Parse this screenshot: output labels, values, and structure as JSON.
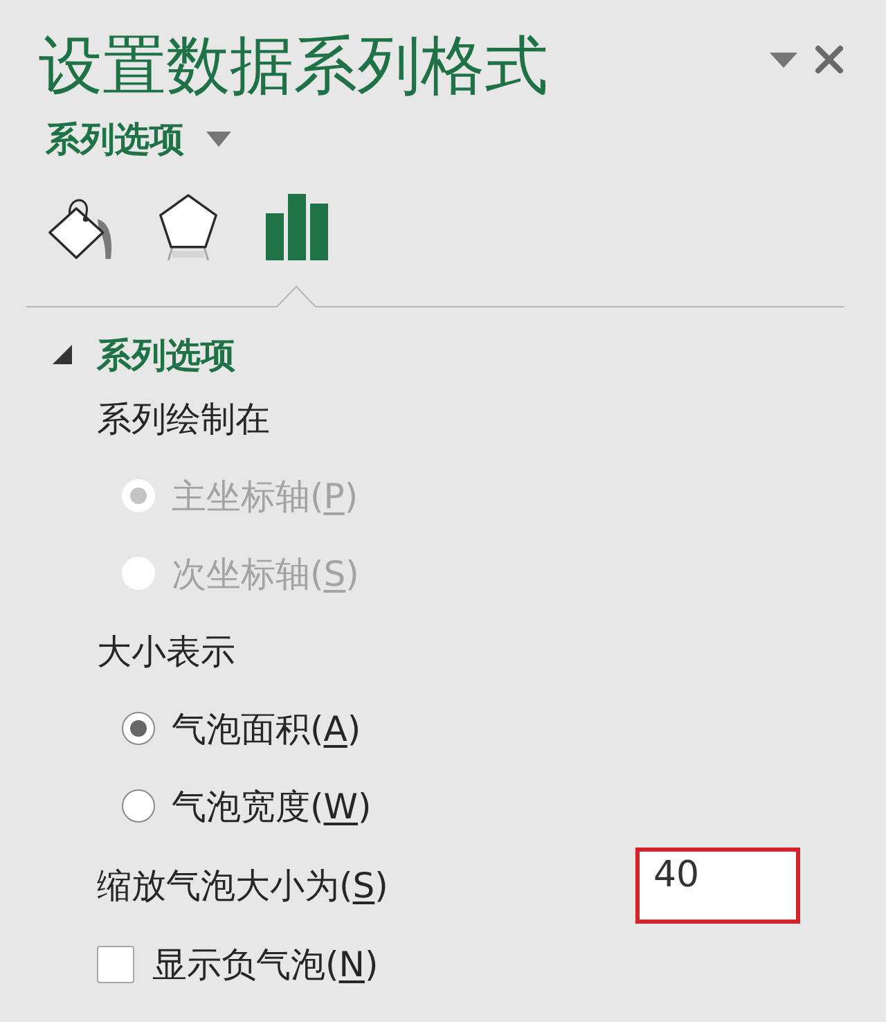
{
  "pane": {
    "title": "设置数据系列格式",
    "options_menu": "系列选项"
  },
  "tabs": [
    {
      "kind": "fill",
      "selected": false
    },
    {
      "kind": "effects",
      "selected": false
    },
    {
      "kind": "series",
      "selected": true
    }
  ],
  "section": {
    "title": "系列选项",
    "expanded": true,
    "items": [
      {
        "kind": "label",
        "text": "系列绘制在"
      },
      {
        "kind": "radio",
        "label": "主坐标轴(",
        "access_key": "P",
        "label_end": ")",
        "selected": true,
        "disabled": true
      },
      {
        "kind": "radio",
        "label": "次坐标轴(",
        "access_key": "S",
        "label_end": ")",
        "selected": false,
        "disabled": true
      },
      {
        "kind": "label",
        "text": "大小表示"
      },
      {
        "kind": "radio",
        "label": "气泡面积(",
        "access_key": "A",
        "label_end": ")",
        "selected": true,
        "disabled": false
      },
      {
        "kind": "radio",
        "label": "气泡宽度(",
        "access_key": "W",
        "label_end": ")",
        "selected": false,
        "disabled": false
      },
      {
        "kind": "number",
        "label": "缩放气泡大小为(",
        "access_key": "S",
        "label_end": ")",
        "value": "40",
        "highlighted": true
      },
      {
        "kind": "checkbox",
        "label": "显示负气泡(",
        "access_key": "N",
        "label_end": ")",
        "checked": false
      }
    ]
  }
}
